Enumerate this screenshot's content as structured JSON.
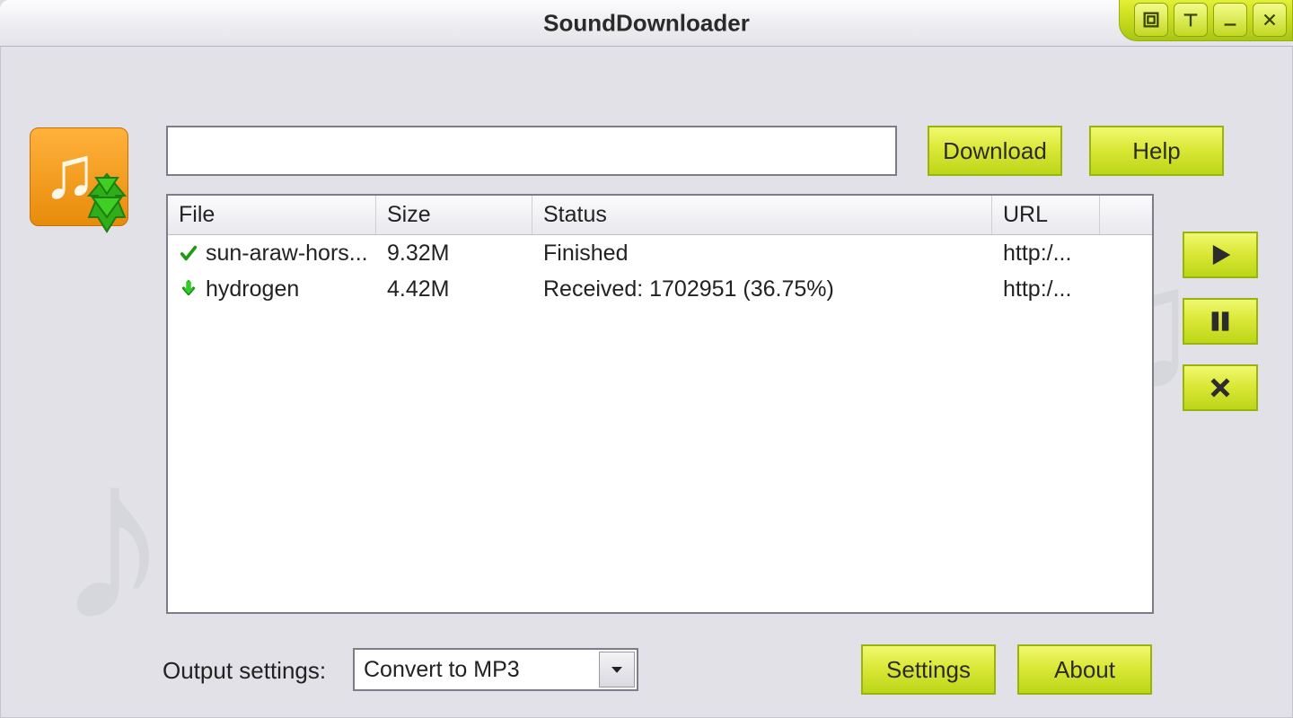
{
  "window": {
    "title": "SoundDownloader"
  },
  "top": {
    "url_value": "",
    "download_label": "Download",
    "help_label": "Help"
  },
  "table": {
    "headers": {
      "file": "File",
      "size": "Size",
      "status": "Status",
      "url": "URL"
    },
    "rows": [
      {
        "icon": "check",
        "file": "sun-araw-hors...",
        "size": "9.32M",
        "status": "Finished",
        "url": "http:/..."
      },
      {
        "icon": "downloading",
        "file": "hydrogen",
        "size": "4.42M",
        "status": "Received: 1702951 (36.75%)",
        "url": "http:/..."
      }
    ]
  },
  "output": {
    "label": "Output settings:",
    "selected": "Convert to MP3"
  },
  "bottom": {
    "settings_label": "Settings",
    "about_label": "About"
  }
}
